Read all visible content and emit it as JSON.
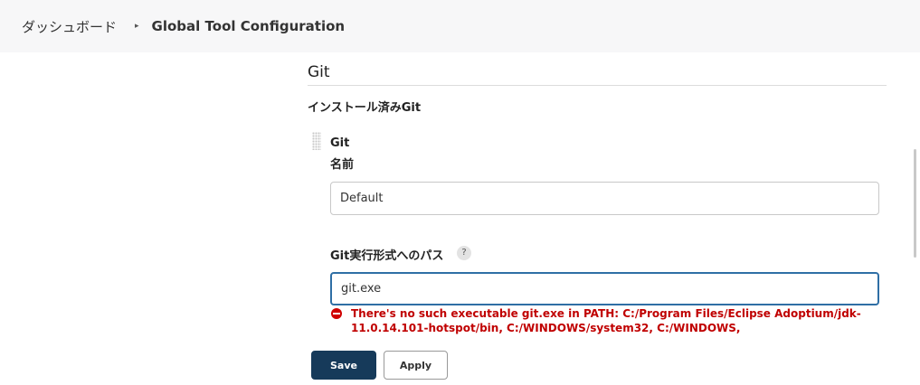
{
  "breadcrumb": {
    "home": "ダッシュボード",
    "separator": "▸",
    "current": "Global Tool Configuration"
  },
  "section": {
    "title": "Git",
    "subtitle": "インストール済みGit"
  },
  "installation": {
    "name_heading": "Git",
    "name_label": "名前",
    "name_value": "Default",
    "path_label": "Git実行形式へのパス",
    "help_label": "?",
    "path_value": "git.exe",
    "error_message": "There's no such executable git.exe in PATH: C:/Program Files/Eclipse Adoptium/jdk-11.0.14.101-hotspot/bin, C:/WINDOWS/system32, C:/WINDOWS,"
  },
  "buttons": {
    "save": "Save",
    "apply": "Apply"
  },
  "colors": {
    "error": "#c00000",
    "save_button": "#163a5a",
    "focus_border": "#2f6fa5"
  }
}
